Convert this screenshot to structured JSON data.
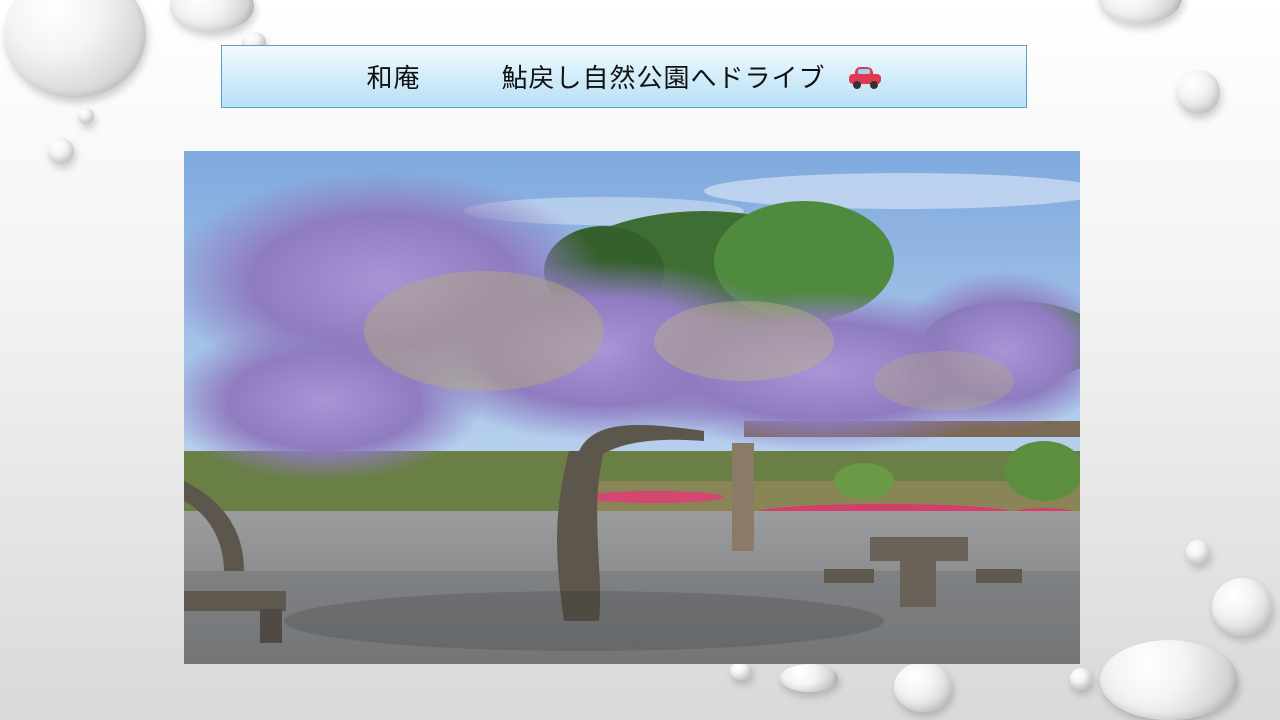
{
  "slide": {
    "title": "和庵　　　鮎戻し自然公園へドライブ",
    "title_icon": "car-icon"
  },
  "photo": {
    "subject": "wisteria-trellis-photo"
  },
  "colors": {
    "title_bg": "#cdeaf9",
    "title_border": "#5aa0c8",
    "wisteria": "#9b86c9"
  }
}
